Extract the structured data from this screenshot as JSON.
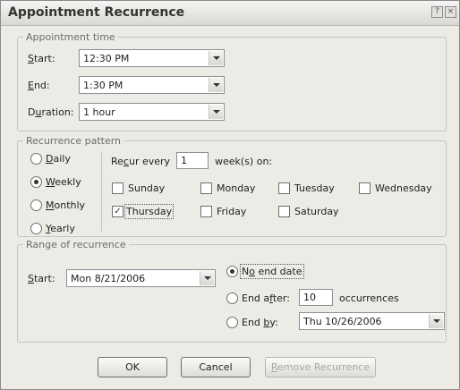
{
  "dialog": {
    "title": "Appointment Recurrence",
    "help_glyph": "?",
    "close_glyph": "×"
  },
  "appointment_time": {
    "legend": "Appointment time",
    "start": {
      "label_prefix": "",
      "label_key": "S",
      "label_rest": "tart:",
      "value": "12:30 PM"
    },
    "end": {
      "label_prefix": "",
      "label_key": "E",
      "label_rest": "nd:",
      "value": "1:30 PM"
    },
    "duration": {
      "label_prefix": "D",
      "label_key": "u",
      "label_rest": "ration:",
      "value": "1 hour"
    }
  },
  "recurrence_pattern": {
    "legend": "Recurrence pattern",
    "frequencies": [
      {
        "key": "D",
        "rest": "aily",
        "selected": false
      },
      {
        "key": "W",
        "rest": "eekly",
        "selected": true
      },
      {
        "key": "M",
        "rest": "onthly",
        "selected": false
      },
      {
        "key": "Y",
        "rest": "early",
        "selected": false
      }
    ],
    "recur_every": {
      "prefix": "Re",
      "key": "c",
      "rest": "ur every",
      "value": "1",
      "suffix": "week(s) on:"
    },
    "days": [
      {
        "label": "Sunday",
        "checked": false
      },
      {
        "label": "Monday",
        "checked": false
      },
      {
        "label": "Tuesday",
        "checked": false
      },
      {
        "label": "Wednesday",
        "checked": false
      },
      {
        "label": "Thursday",
        "checked": true
      },
      {
        "label": "Friday",
        "checked": false
      },
      {
        "label": "Saturday",
        "checked": false
      }
    ],
    "check_glyph": "✓"
  },
  "range": {
    "legend": "Range of recurrence",
    "start": {
      "label_prefix": "",
      "label_key": "S",
      "label_rest": "tart:",
      "value": "Mon 8/21/2006"
    },
    "no_end": {
      "prefix": "N",
      "key": "o",
      "rest": " end date",
      "selected": true
    },
    "end_after": {
      "prefix": "End a",
      "key": "f",
      "rest": "ter:",
      "value": "10",
      "suffix": "occurrences",
      "selected": false
    },
    "end_by": {
      "prefix": "End ",
      "key": "b",
      "rest": "y:",
      "value": "Thu 10/26/2006",
      "selected": false
    }
  },
  "buttons": {
    "ok": "OK",
    "cancel": "Cancel",
    "remove_key": "R",
    "remove_rest": "emove Recurrence"
  }
}
